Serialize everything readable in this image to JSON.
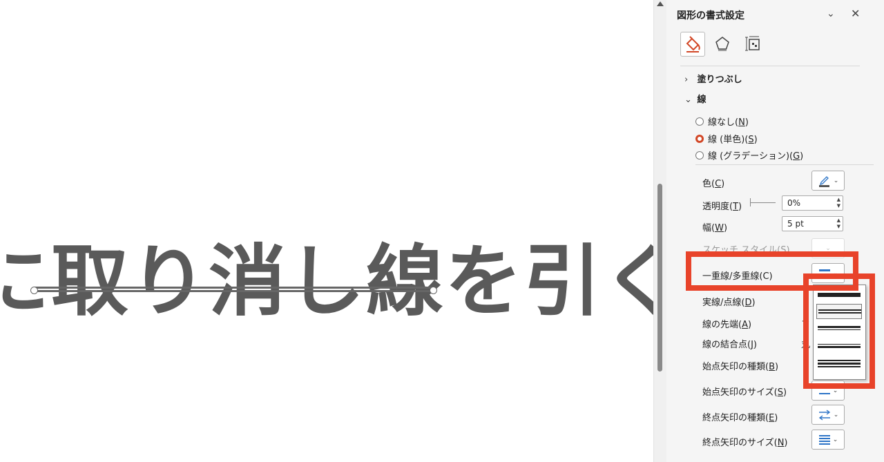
{
  "slide": {
    "text": "に取り消し線を引く"
  },
  "pane": {
    "title": "図形の書式設定",
    "tabs": [
      {
        "icon": "fill-bucket-icon"
      },
      {
        "icon": "pentagon-effects-icon"
      },
      {
        "icon": "size-properties-icon"
      }
    ],
    "sections": {
      "fill": "塗りつぶし",
      "line": "線"
    },
    "radios": [
      {
        "label": "線なし(",
        "key": "N",
        "checked": false
      },
      {
        "label": "線 (単色)(",
        "key": "S",
        "checked": true
      },
      {
        "label": "線 (グラデーション)(",
        "key": "G",
        "checked": false
      }
    ],
    "props": {
      "color": {
        "label": "色(",
        "key": "C"
      },
      "transparency": {
        "label": "透明度(",
        "key": "T",
        "value": "0%"
      },
      "width": {
        "label": "幅(",
        "key": "W",
        "value": "5 pt"
      },
      "sketch": {
        "label": "スケッチ スタイル(S)"
      },
      "compound": {
        "label": "一重線/多重線(C)"
      },
      "dash": {
        "label": "実線/点線(",
        "key": "D"
      },
      "cap": {
        "label": "線の先端(",
        "key": "A",
        "value": "フ"
      },
      "join": {
        "label": "線の結合点(",
        "key": "J",
        "value": "丸"
      },
      "begin_type": {
        "label": "始点矢印の種類(",
        "key": "B"
      },
      "begin_size": {
        "label": "始点矢印のサイズ(",
        "key": "S"
      },
      "end_type": {
        "label": "終点矢印の種類(",
        "key": "E"
      },
      "end_size": {
        "label": "終点矢印のサイズ(",
        "key": "N"
      }
    }
  },
  "colors": {
    "accent": "#d24726",
    "highlight": "#e8432a",
    "icon_blue": "#2e75c7"
  }
}
